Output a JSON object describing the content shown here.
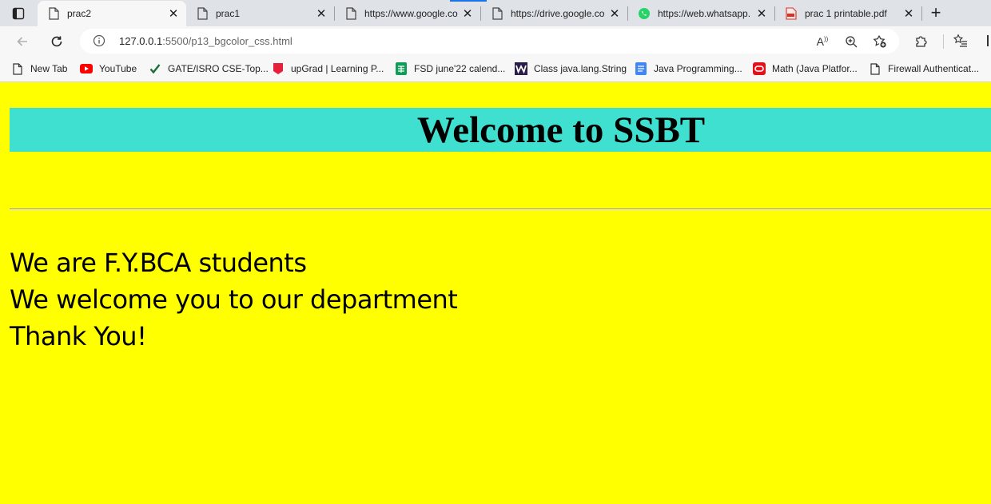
{
  "browser": {
    "tabs": [
      {
        "label": "prac2",
        "icon": "page-icon",
        "active": true
      },
      {
        "label": "prac1",
        "icon": "page-icon",
        "active": false
      },
      {
        "label": "https://www.google.co",
        "icon": "page-icon",
        "active": false
      },
      {
        "label": "https://drive.google.co",
        "icon": "page-icon",
        "active": false
      },
      {
        "label": "https://web.whatsapp.",
        "icon": "whatsapp-icon",
        "active": false
      },
      {
        "label": "prac 1 printable.pdf",
        "icon": "pdf-icon",
        "active": false
      }
    ],
    "address": {
      "host": "127.0.0.1",
      "rest": ":5500/p13_bgcolor_css.html"
    },
    "favorites": [
      {
        "label": "New Tab",
        "icon": "page-icon"
      },
      {
        "label": "YouTube",
        "icon": "youtube-icon"
      },
      {
        "label": "GATE/ISRO CSE-Top...",
        "icon": "checkmark-icon"
      },
      {
        "label": "upGrad | Learning P...",
        "icon": "upgrad-icon"
      },
      {
        "label": "FSD june'22 calend...",
        "icon": "sheets-icon"
      },
      {
        "label": "Class java.lang.String",
        "icon": "w-logo-icon"
      },
      {
        "label": "Java Programming...",
        "icon": "docs-icon"
      },
      {
        "label": "Math (Java Platfor...",
        "icon": "oracle-icon"
      },
      {
        "label": "Firewall Authenticat...",
        "icon": "page-icon"
      }
    ],
    "read_aloud_label": "A"
  },
  "page": {
    "heading": "Welcome to SSBT",
    "lines": [
      "We are F.Y.BCA students",
      "We welcome you to our department",
      "Thank You!"
    ],
    "colors": {
      "background": "#ffff00",
      "banner": "#40e0d0"
    }
  }
}
